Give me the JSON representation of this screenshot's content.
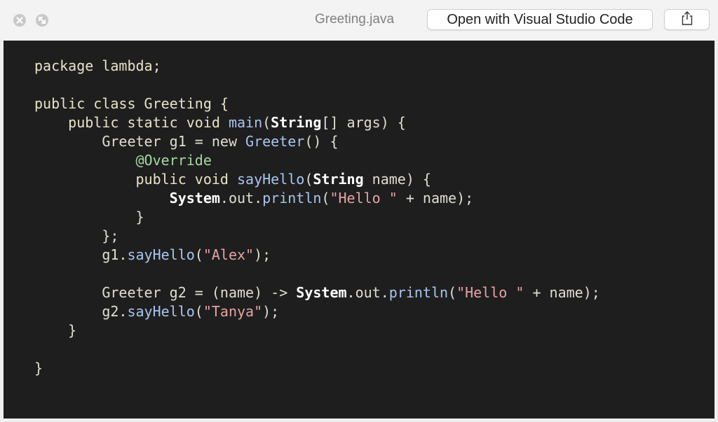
{
  "window": {
    "title": "Greeting.java",
    "open_button_label": "Open with Visual Studio Code",
    "share_icon": "share-icon",
    "traffic_lights": [
      "close-icon",
      "minimize-icon"
    ]
  },
  "colors": {
    "background": "#1e1e1e",
    "keyword": "#e9e3c8",
    "function": "#a9c5f0",
    "string": "#e6a4a4",
    "annotation": "#a6d8a0",
    "bold_type": "#ffffff"
  },
  "code": {
    "lines": [
      [
        {
          "t": "package lambda;",
          "c": "kw"
        }
      ],
      [],
      [
        {
          "t": "public class Greeting {",
          "c": "kw"
        }
      ],
      [
        {
          "t": "    public static void ",
          "c": "kw"
        },
        {
          "t": "main",
          "c": "fn"
        },
        {
          "t": "(",
          "c": "plain"
        },
        {
          "t": "String",
          "c": "bold"
        },
        {
          "t": "[] args) {",
          "c": "plain"
        }
      ],
      [
        {
          "t": "        Greeter g1 = new ",
          "c": "plain"
        },
        {
          "t": "Greeter",
          "c": "fn"
        },
        {
          "t": "() {",
          "c": "plain"
        }
      ],
      [
        {
          "t": "            @Override",
          "c": "ann"
        }
      ],
      [
        {
          "t": "            public void ",
          "c": "kw"
        },
        {
          "t": "sayHello",
          "c": "fn"
        },
        {
          "t": "(",
          "c": "plain"
        },
        {
          "t": "String",
          "c": "bold"
        },
        {
          "t": " name) {",
          "c": "plain"
        }
      ],
      [
        {
          "t": "                ",
          "c": "plain"
        },
        {
          "t": "System",
          "c": "bold"
        },
        {
          "t": ".out.",
          "c": "plain"
        },
        {
          "t": "println",
          "c": "fn"
        },
        {
          "t": "(",
          "c": "plain"
        },
        {
          "t": "\"Hello \"",
          "c": "str"
        },
        {
          "t": " + name);",
          "c": "plain"
        }
      ],
      [
        {
          "t": "            }",
          "c": "plain"
        }
      ],
      [
        {
          "t": "        };",
          "c": "plain"
        }
      ],
      [
        {
          "t": "        g1.",
          "c": "plain"
        },
        {
          "t": "sayHello",
          "c": "fn"
        },
        {
          "t": "(",
          "c": "plain"
        },
        {
          "t": "\"Alex\"",
          "c": "str"
        },
        {
          "t": ");",
          "c": "plain"
        }
      ],
      [],
      [
        {
          "t": "        Greeter g2 = (name) -> ",
          "c": "plain"
        },
        {
          "t": "System",
          "c": "bold"
        },
        {
          "t": ".out.",
          "c": "plain"
        },
        {
          "t": "println",
          "c": "fn"
        },
        {
          "t": "(",
          "c": "plain"
        },
        {
          "t": "\"Hello \"",
          "c": "str"
        },
        {
          "t": " + name);",
          "c": "plain"
        }
      ],
      [
        {
          "t": "        g2.",
          "c": "plain"
        },
        {
          "t": "sayHello",
          "c": "fn"
        },
        {
          "t": "(",
          "c": "plain"
        },
        {
          "t": "\"Tanya\"",
          "c": "str"
        },
        {
          "t": ");",
          "c": "plain"
        }
      ],
      [
        {
          "t": "    }",
          "c": "plain"
        }
      ],
      [],
      [
        {
          "t": "}",
          "c": "plain"
        }
      ]
    ]
  }
}
